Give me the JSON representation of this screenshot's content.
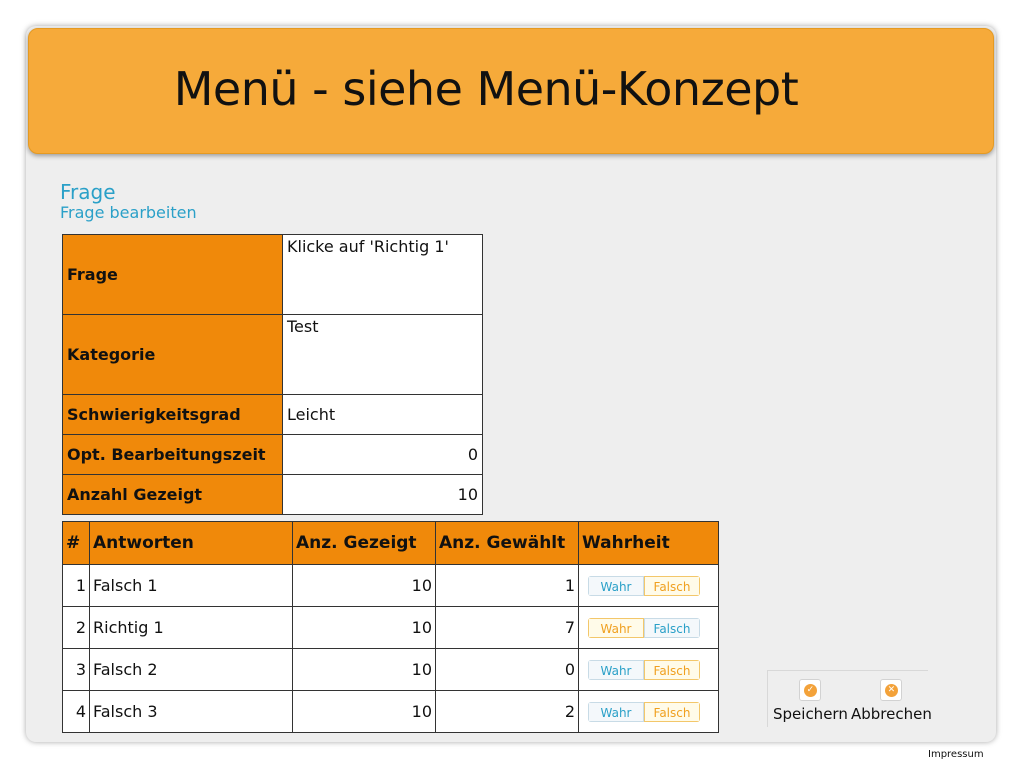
{
  "menu": {
    "title": "Menü - siehe Menü-Konzept"
  },
  "header": {
    "title": "Frage",
    "subtitle": "Frage bearbeiten"
  },
  "details": {
    "frage": {
      "label": "Frage",
      "value": "Klicke auf 'Richtig 1'"
    },
    "kategorie": {
      "label": "Kategorie",
      "value": "Test"
    },
    "schwierigkeit": {
      "label": "Schwierigkeitsgrad",
      "value": "Leicht"
    },
    "zeit": {
      "label": "Opt. Bearbeitungszeit",
      "value": "0"
    },
    "gezeigt": {
      "label": "Anzahl Gezeigt",
      "value": "10"
    }
  },
  "answers": {
    "headers": {
      "idx": "#",
      "antwort": "Antworten",
      "gezeigt": "Anz. Gezeigt",
      "gewaehlt": "Anz. Gewählt",
      "wahrheit": "Wahrheit"
    },
    "toggle_labels": {
      "true": "Wahr",
      "false": "Falsch"
    },
    "rows": [
      {
        "idx": "1",
        "antwort": "Falsch 1",
        "gezeigt": "10",
        "gewaehlt": "1",
        "wahrheit": "Falsch"
      },
      {
        "idx": "2",
        "antwort": "Richtig 1",
        "gezeigt": "10",
        "gewaehlt": "7",
        "wahrheit": "Wahr"
      },
      {
        "idx": "3",
        "antwort": "Falsch 2",
        "gezeigt": "10",
        "gewaehlt": "0",
        "wahrheit": "Falsch"
      },
      {
        "idx": "4",
        "antwort": "Falsch 3",
        "gezeigt": "10",
        "gewaehlt": "2",
        "wahrheit": "Falsch"
      }
    ]
  },
  "actions": {
    "save": "Speichern",
    "cancel": "Abbrechen",
    "save_icon": "check-icon",
    "cancel_icon": "close-icon"
  },
  "footer": {
    "impressum": "Impressum"
  },
  "colors": {
    "accent_orange": "#f0890a",
    "menu_orange": "#f6aa3a",
    "link_blue": "#2aa0c8"
  }
}
